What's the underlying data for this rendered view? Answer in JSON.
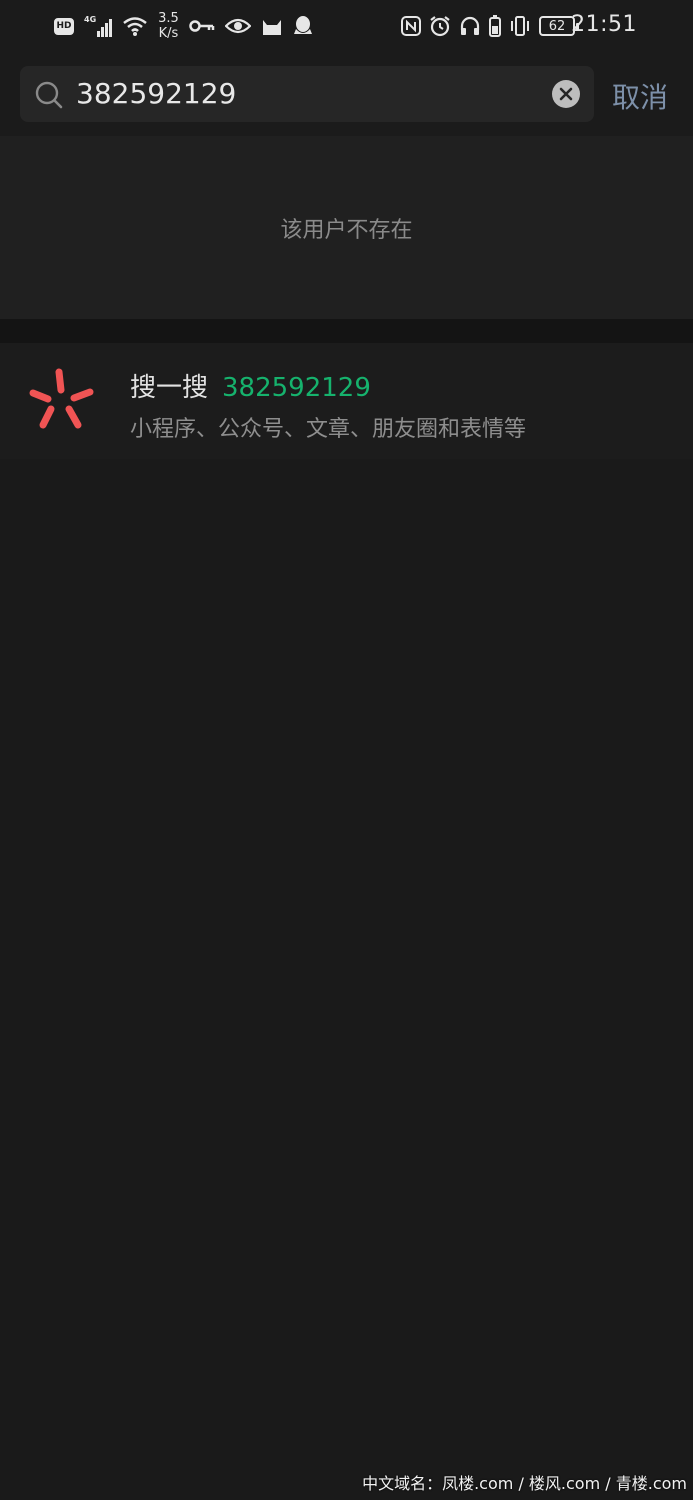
{
  "status_bar": {
    "hd_label": "HD",
    "network_label": "4G",
    "speed_value": "3.5",
    "speed_unit": "K/s",
    "battery_level": "62",
    "time": "21:51",
    "icons": [
      "hd-icon",
      "signal-icon",
      "wifi-icon",
      "key-icon",
      "eye-icon",
      "cat-icon",
      "qq-icon",
      "nfc-icon",
      "alarm-icon",
      "headset-icon",
      "battery-saver-icon",
      "vibrate-icon",
      "battery-icon"
    ]
  },
  "search": {
    "query": "382592129",
    "cancel_label": "取消"
  },
  "results": {
    "no_user_message": "该用户不存在",
    "search_one_search": {
      "label": "搜一搜",
      "query": "382592129",
      "subtitle": "小程序、公众号、文章、朋友圈和表情等"
    }
  },
  "watermark": "中文域名：凤楼.com / 楼风.com / 青楼.com",
  "colors": {
    "background": "#1a1a1a",
    "accent_green": "#16b26d",
    "cancel_blue": "#7d90a9",
    "sou_icon_red": "#f05454"
  }
}
